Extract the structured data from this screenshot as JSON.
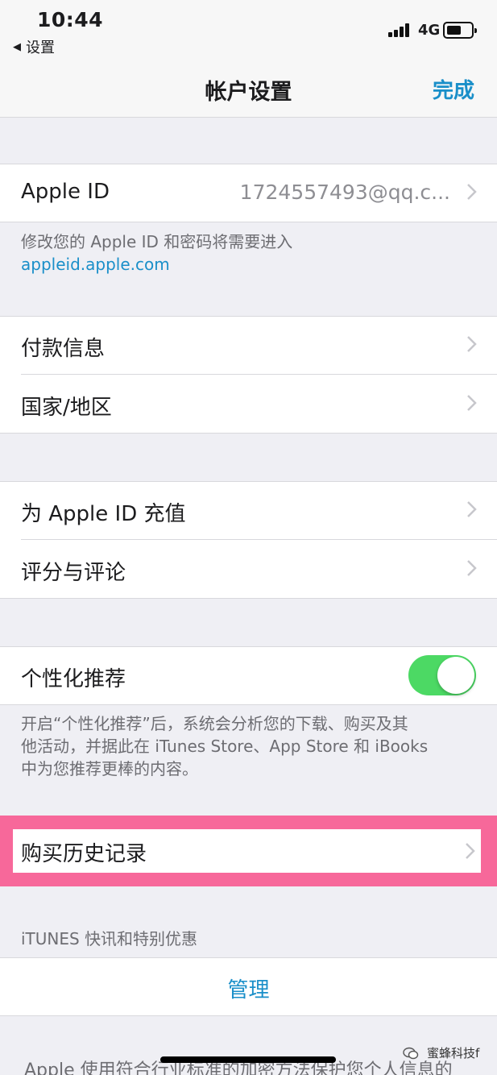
{
  "status_bar": {
    "time": "10:44",
    "back_app": "设置",
    "network": "4G"
  },
  "nav": {
    "title": "帐户设置",
    "done": "完成"
  },
  "apple_id": {
    "label": "Apple ID",
    "value": "1724557493@qq.c..."
  },
  "apple_id_footer": {
    "line1": "修改您的 Apple ID 和密码将需要进入",
    "link": "appleid.apple.com"
  },
  "group1": [
    {
      "label": "付款信息"
    },
    {
      "label": "国家/地区"
    }
  ],
  "group2": [
    {
      "label": "为 Apple ID 充值"
    },
    {
      "label": "评分与评论"
    }
  ],
  "personalization": {
    "label": "个性化推荐",
    "enabled": true,
    "footer": [
      "开启“个性化推荐”后，系统会分析您的下载、购买及其",
      "他活动，并据此在 iTunes Store、App Store 和 iBooks",
      "中为您推荐更棒的内容。"
    ]
  },
  "purchase_history": {
    "label": "购买历史记录"
  },
  "itunes_section": {
    "header": "iTUNES 快讯和特别优惠",
    "manage": "管理"
  },
  "bottom_text": "Apple 使用符合行业标准的加密方法保护您个人信息的",
  "watermark": "蜜蜂科技f",
  "colors": {
    "accent": "#1a8fc9",
    "toggle_on": "#4cd964",
    "highlight": "#f7689a",
    "background": "#efeff4"
  }
}
